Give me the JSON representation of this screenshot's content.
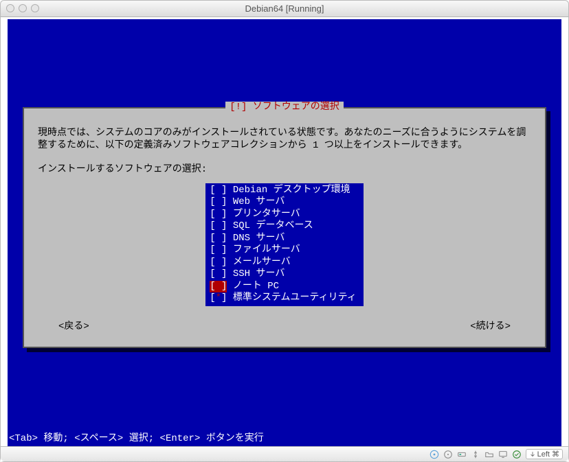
{
  "window": {
    "title": "Debian64 [Running]"
  },
  "dialog": {
    "title": "[!] ソフトウェアの選択",
    "description": "現時点では、システムのコアのみがインストールされている状態です。あなたのニーズに合うようにシステムを調整するために、以下の定義済みソフトウェアコレクションから 1 つ以上をインストールできます。",
    "prompt": "インストールするソフトウェアの選択:",
    "items": [
      {
        "label": "Debian デスクトップ環境",
        "checked": false,
        "selected": false
      },
      {
        "label": "Web サーバ",
        "checked": false,
        "selected": false
      },
      {
        "label": "プリンタサーバ",
        "checked": false,
        "selected": false
      },
      {
        "label": "SQL データベース",
        "checked": false,
        "selected": false
      },
      {
        "label": "DNS サーバ",
        "checked": false,
        "selected": false
      },
      {
        "label": "ファイルサーバ",
        "checked": false,
        "selected": false
      },
      {
        "label": "メールサーバ",
        "checked": false,
        "selected": false
      },
      {
        "label": "SSH サーバ",
        "checked": false,
        "selected": false
      },
      {
        "label": "ノート PC",
        "checked": false,
        "selected": true
      },
      {
        "label": "標準システムユーティリティ",
        "checked": true,
        "selected": false
      }
    ],
    "back": "<戻る>",
    "continue": "<続ける>"
  },
  "hint": "<Tab> 移動;  <スペース> 選択;  <Enter> ボタンを実行",
  "statusbar": {
    "host_key": "Left ⌘"
  }
}
